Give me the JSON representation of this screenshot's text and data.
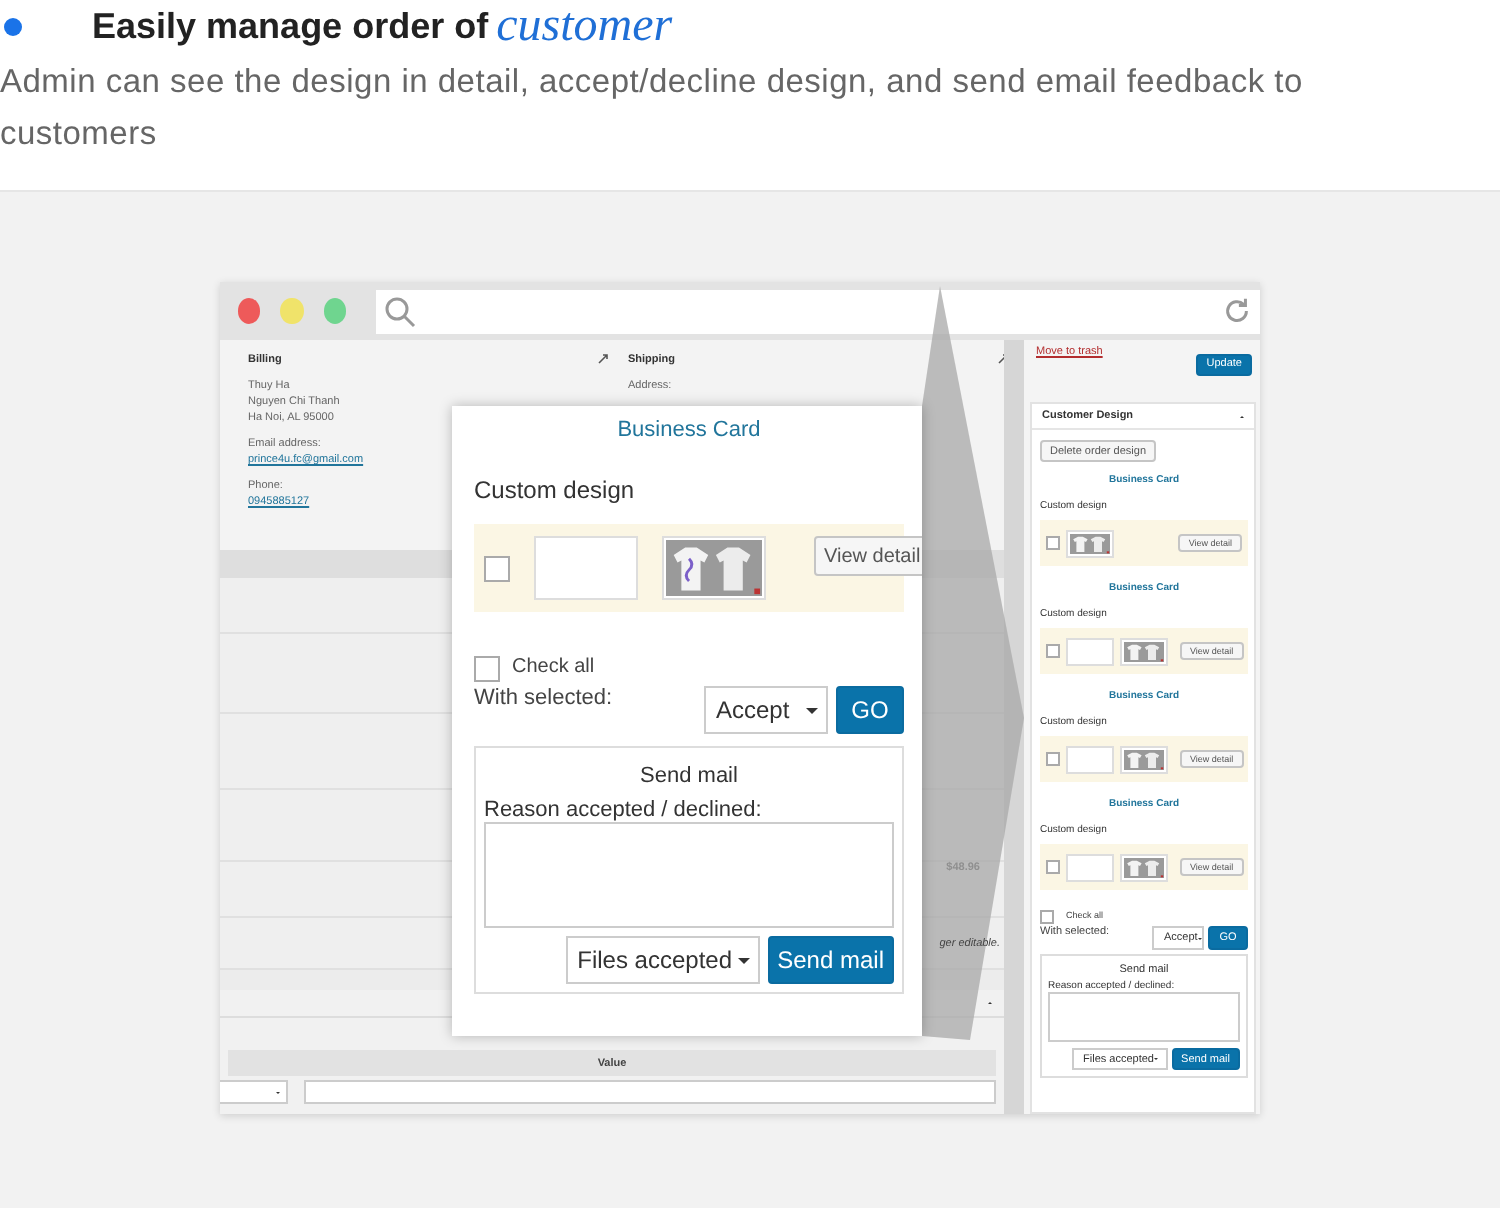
{
  "heading": {
    "text": "Easily manage order of",
    "highlight": "customer"
  },
  "description": "Admin can see the design in detail, accept/decline design, and send email feedback to customers",
  "order": {
    "billing": {
      "title": "Billing",
      "lines": [
        "Thuy Ha",
        "Nguyen Chi Thanh",
        "Ha Noi, AL 95000"
      ],
      "email_label": "Email address:",
      "email": "prince4u.fc@gmail.com",
      "phone_label": "Phone:",
      "phone": "0945885127"
    },
    "shipping": {
      "title": "Shipping",
      "address_label": "Address:"
    },
    "total": "$48.96",
    "note": "ger editable.",
    "meta_column": "Value"
  },
  "sidebar": {
    "trash_link": "Move to trash",
    "update_button": "Update",
    "panel_title": "Customer Design",
    "delete_button": "Delete order design",
    "designs": [
      {
        "title": "Business Card",
        "label": "Custom design",
        "has_blank": false,
        "checked": false,
        "button": "View detail"
      },
      {
        "title": "Business Card",
        "label": "Custom design",
        "has_blank": true,
        "checked": false,
        "button": "View detail"
      },
      {
        "title": "Business Card",
        "label": "Custom design",
        "has_blank": true,
        "checked": false,
        "button": "View detail"
      },
      {
        "title": "Business Card",
        "label": "Custom design",
        "has_blank": true,
        "checked": false,
        "button": "View detail"
      }
    ],
    "check_all": {
      "label": "Check all",
      "checked": false
    },
    "with_selected": "With selected:",
    "action": "Accept",
    "go_button": "GO",
    "mail": {
      "title": "Send mail",
      "reason_label": "Reason accepted / declined:",
      "files_select": "Files accepted",
      "send_button": "Send mail"
    }
  },
  "popup": {
    "title": "Business Card",
    "label": "Custom design",
    "design": {
      "checked": false,
      "has_blank": true,
      "button": "View detail"
    },
    "check_all": {
      "label": "Check all",
      "checked": false
    },
    "with_selected": "With selected:",
    "action": "Accept",
    "go_button": "GO",
    "mail": {
      "title": "Send mail",
      "reason_label": "Reason accepted / declined:",
      "files_select": "Files accepted",
      "send_button": "Send mail"
    }
  }
}
